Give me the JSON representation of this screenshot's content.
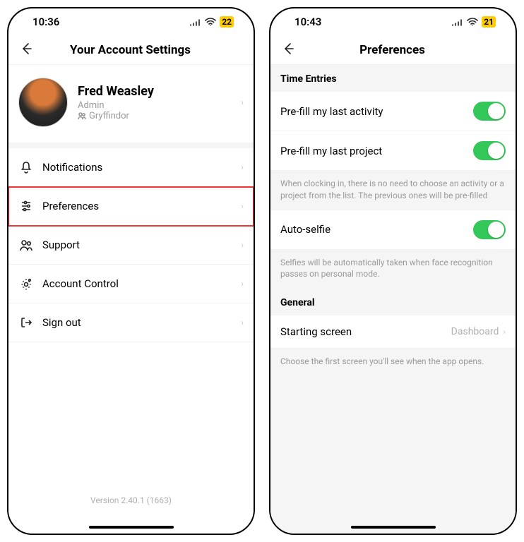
{
  "left": {
    "status": {
      "time": "10:36",
      "battery": "22"
    },
    "header": {
      "title": "Your Account Settings"
    },
    "profile": {
      "name": "Fred Weasley",
      "role": "Admin",
      "team": "Gryffindor"
    },
    "menu": [
      {
        "icon": "bell-icon",
        "label": "Notifications",
        "highlighted": false
      },
      {
        "icon": "sliders-icon",
        "label": "Preferences",
        "highlighted": true
      },
      {
        "icon": "users-icon",
        "label": "Support",
        "highlighted": false
      },
      {
        "icon": "gear-icon",
        "label": "Account Control",
        "highlighted": false
      },
      {
        "icon": "signout-icon",
        "label": "Sign out",
        "highlighted": false
      }
    ],
    "version": "Version 2.40.1 (1663)"
  },
  "right": {
    "status": {
      "time": "10:43",
      "battery": "21"
    },
    "header": {
      "title": "Preferences"
    },
    "sections": {
      "timeEntries": {
        "title": "Time Entries",
        "rows": [
          {
            "label": "Pre-fill my last activity",
            "on": true
          },
          {
            "label": "Pre-fill my last project",
            "on": true
          }
        ],
        "help1": "When clocking in, there is no need to choose an activity or a project from the list. The previous ones will be pre-filled",
        "autoSelfie": {
          "label": "Auto-selfie",
          "on": true
        },
        "help2": "Selfies will be automatically taken when face recognition passes on personal mode."
      },
      "general": {
        "title": "General",
        "startingScreen": {
          "label": "Starting screen",
          "value": "Dashboard"
        },
        "help": "Choose the first screen you'll see when the app opens."
      }
    }
  }
}
